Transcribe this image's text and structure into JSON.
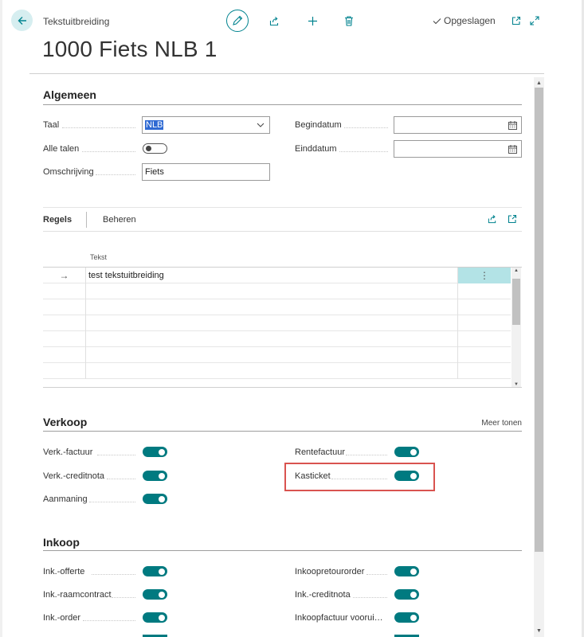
{
  "header": {
    "caption": "Tekstuitbreiding",
    "title": "1000 Fiets NLB 1",
    "saved_label": "Opgeslagen"
  },
  "algemeen": {
    "title": "Algemeen",
    "taal_label": "Taal",
    "taal_value": "NLB",
    "alle_talen_label": "Alle talen",
    "alle_talen_on": false,
    "omschrijving_label": "Omschrijving",
    "omschrijving_value": "Fiets",
    "begindatum_label": "Begindatum",
    "begindatum_value": "",
    "einddatum_label": "Einddatum",
    "einddatum_value": ""
  },
  "regels": {
    "tab_regels": "Regels",
    "tab_beheren": "Beheren",
    "column_header": "Tekst",
    "rows": [
      "test tekstuitbreiding",
      "",
      "",
      "",
      "",
      "",
      ""
    ],
    "row_arrow": "→",
    "actions_glyph": "⋮"
  },
  "verkoop": {
    "title": "Verkoop",
    "more_label": "Meer tonen",
    "left": [
      {
        "label": "Verk.-factuur",
        "on": true
      },
      {
        "label": "Verk.-creditnota",
        "on": true
      },
      {
        "label": "Aanmaning",
        "on": true
      }
    ],
    "right": [
      {
        "label": "Rentefactuur",
        "on": true
      },
      {
        "label": "Kasticket",
        "on": true
      }
    ]
  },
  "inkoop": {
    "title": "Inkoop",
    "left": [
      {
        "label": "Ink.-offerte",
        "on": true
      },
      {
        "label": "Ink.-raamcontract",
        "on": true
      },
      {
        "label": "Ink.-order",
        "on": true
      }
    ],
    "right": [
      {
        "label": "Inkoopretourorder",
        "on": true
      },
      {
        "label": "Ink.-creditnota",
        "on": true
      },
      {
        "label": "Inkoopfactuur voorui…",
        "on": true
      }
    ]
  },
  "colors": {
    "accent": "#007a80",
    "highlight": "#d9534f"
  },
  "icons": {
    "back": "back-arrow-icon",
    "edit": "pencil-icon",
    "share": "share-icon",
    "add": "plus-icon",
    "delete": "trash-icon",
    "saved": "checkmark-icon",
    "open_new": "open-in-new-window-icon",
    "expand": "expand-icon",
    "calendar": "calendar-icon"
  }
}
